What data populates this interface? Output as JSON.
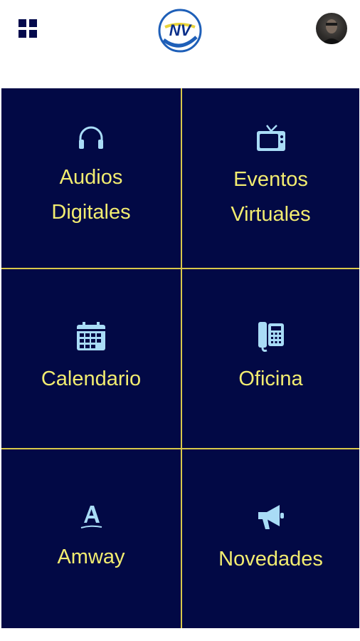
{
  "header": {
    "menu_icon": "grid-menu-icon",
    "logo_text": "NV",
    "avatar": "user-avatar"
  },
  "colors": {
    "tile_bg": "#020945",
    "tile_text": "#f2ec70",
    "icon": "#a9dcf6",
    "divider": "#d9c84a"
  },
  "tiles": [
    {
      "label": "Audios\nDigitales",
      "icon": "headphones-icon"
    },
    {
      "label": "Eventos\nVirtuales",
      "icon": "tv-icon"
    },
    {
      "label": "Calendario",
      "icon": "calendar-icon"
    },
    {
      "label": "Oficina",
      "icon": "phone-icon"
    },
    {
      "label": "Amway",
      "icon": "amway-icon"
    },
    {
      "label": "Novedades",
      "icon": "megaphone-icon"
    }
  ]
}
